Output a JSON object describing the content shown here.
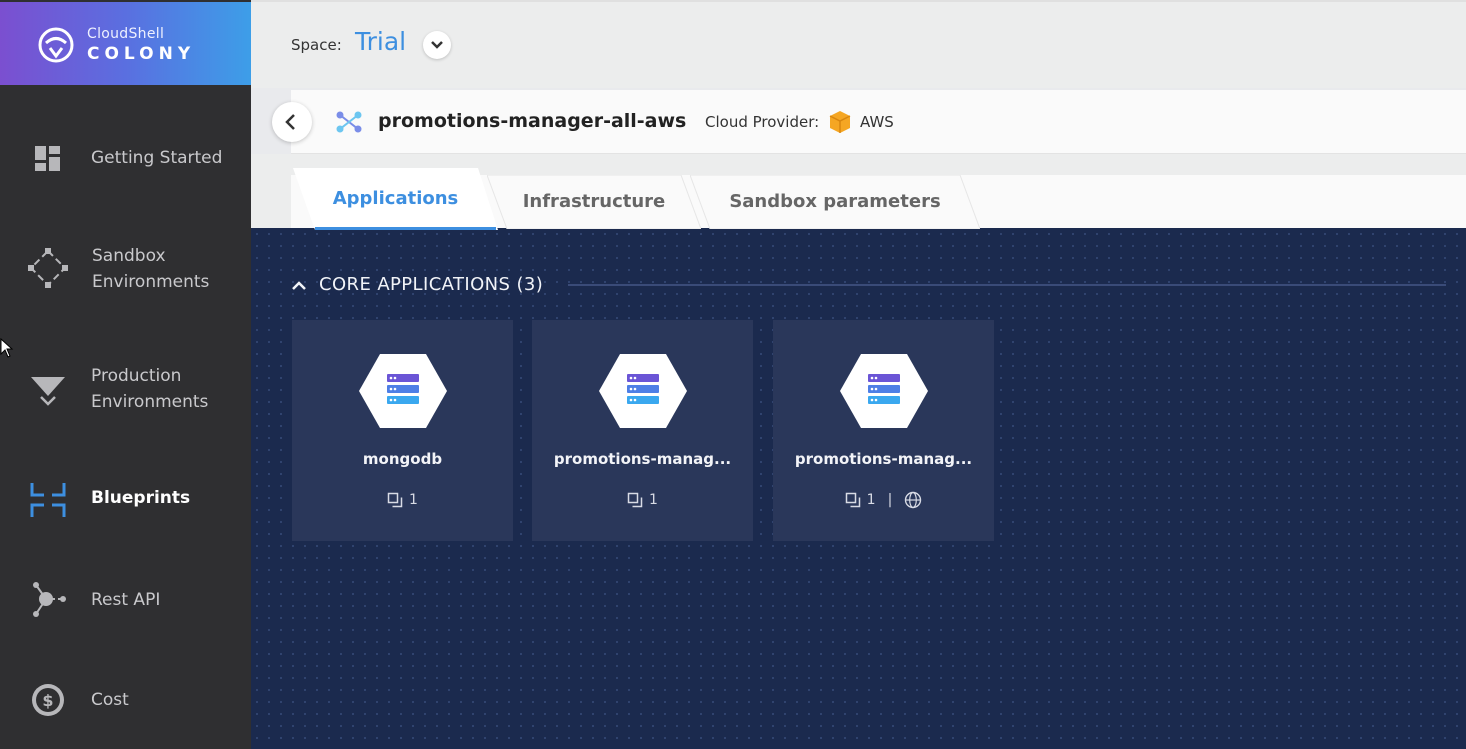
{
  "brand": {
    "line1": "CloudShell",
    "line2": "COLONY"
  },
  "sidebar": {
    "items": [
      {
        "label": "Getting Started",
        "icon": "dashboard-icon"
      },
      {
        "label1": "Sandbox",
        "label2": "Environments",
        "icon": "sandbox-icon"
      },
      {
        "label1": "Production",
        "label2": "Environments",
        "icon": "production-icon"
      },
      {
        "label": "Blueprints",
        "icon": "blueprints-icon",
        "active": true
      },
      {
        "label": "Rest API",
        "icon": "api-icon"
      },
      {
        "label": "Cost",
        "icon": "cost-icon"
      }
    ]
  },
  "topbar": {
    "space_label": "Space:",
    "space_value": "Trial"
  },
  "blueprint": {
    "name": "promotions-manager-all-aws",
    "cloud_provider_label": "Cloud Provider:",
    "cloud_provider_value": "AWS"
  },
  "tabs": [
    {
      "label": "Applications",
      "active": true
    },
    {
      "label": "Infrastructure"
    },
    {
      "label": "Sandbox parameters"
    }
  ],
  "section": {
    "title": "CORE APPLICATIONS (3)"
  },
  "cards": [
    {
      "name": "mongodb",
      "instances": "1"
    },
    {
      "name": "promotions-manag...",
      "instances": "1"
    },
    {
      "name": "promotions-manag...",
      "instances": "1",
      "separator": "|"
    }
  ],
  "colors": {
    "accent": "#3d8fe0",
    "main_bg": "#1b2a4e",
    "card_bg": "#2a375a",
    "sidebar_bg": "#2f2f31"
  }
}
